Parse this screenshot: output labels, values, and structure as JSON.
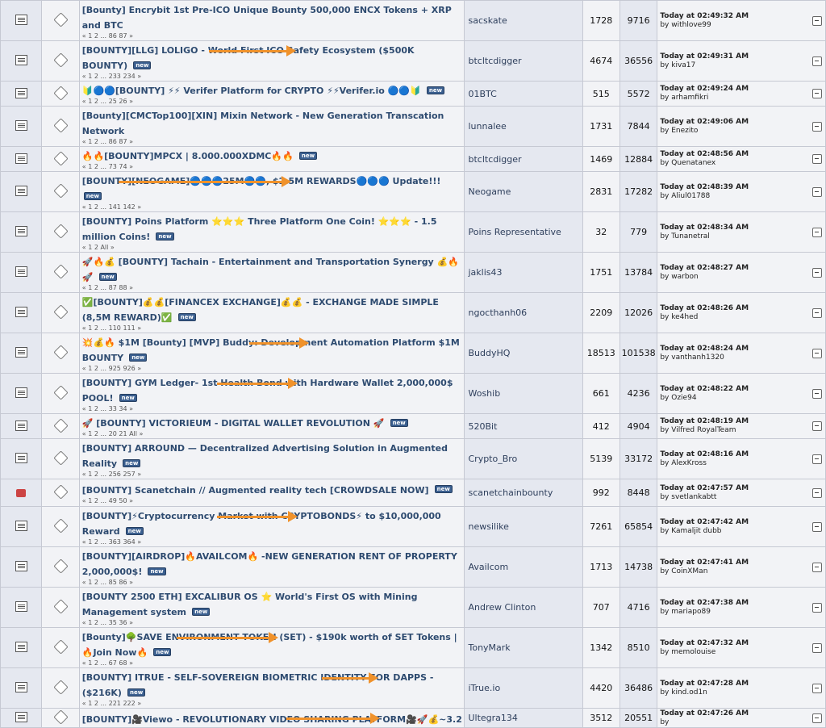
{
  "rows": [
    {
      "title": "[Bounty] Encrybit 1st Pre-ICO Unique Bounty  500,000 ENCX Tokens + XRP and BTC",
      "new": false,
      "pages": "« 1 2 ... 86 87 »",
      "author": "sacskate",
      "replies": "1728",
      "views": "9716",
      "last_time": "Today at 02:49:32 AM",
      "last_by": "withlove99",
      "icon": "doc",
      "arrow": false
    },
    {
      "title": "[BOUNTY][LLG] LOLIGO - World First ICO Safety Ecosystem ($500K BOUNTY)",
      "new": true,
      "pages": "« 1 2 ... 233 234 »",
      "author": "btcltcdigger",
      "replies": "4674",
      "views": "36556",
      "last_time": "Today at 02:49:31 AM",
      "last_by": "kiva17",
      "icon": "doc",
      "arrow": true
    },
    {
      "title": "🔰🔵🔵[BOUNTY] ⚡⚡ Verifer Platform for CRYPTO ⚡⚡Verifer.io 🔵🔵🔰",
      "new": true,
      "pages": "« 1 2 ... 25 26 »",
      "author": "01BTC",
      "replies": "515",
      "views": "5572",
      "last_time": "Today at 02:49:24 AM",
      "last_by": "arhamfikri",
      "icon": "doc",
      "arrow": false
    },
    {
      "title": "[Bounty][CMCTop100][XIN] Mixin Network - New Generation Transcation Network",
      "new": false,
      "pages": "« 1 2 ... 86 87 »",
      "author": "lunnalee",
      "replies": "1731",
      "views": "7844",
      "last_time": "Today at 02:49:06 AM",
      "last_by": "Enezito",
      "icon": "doc",
      "arrow": false
    },
    {
      "title": "🔥🔥[BOUNTY]MPCX | 8.000.000XDMC🔥🔥",
      "new": true,
      "pages": "« 1 2 ... 73 74 »",
      "author": "btcltcdigger",
      "replies": "1469",
      "views": "12884",
      "last_time": "Today at 02:48:56 AM",
      "last_by": "Quenatanex",
      "icon": "doc",
      "arrow": false
    },
    {
      "title": "[BOUNTY][NEOGAME]🔵🔵🔵25M🔵🔵, $2.5M REWARDS🔵🔵🔵 Update!!!",
      "new": true,
      "pages": "« 1 2 ... 141 142 »",
      "author": "Neogame",
      "replies": "2831",
      "views": "17282",
      "last_time": "Today at 02:48:39 AM",
      "last_by": "Aliul01788",
      "icon": "doc",
      "arrow": true
    },
    {
      "title": "[BOUNTY] Poins Platform ⭐⭐⭐ Three Platform One Coin! ⭐⭐⭐ - 1.5 million Coins!",
      "new": true,
      "pages": "« 1 2  All »",
      "author": "Poins Representative",
      "replies": "32",
      "views": "779",
      "last_time": "Today at 02:48:34 AM",
      "last_by": "Tunanetral",
      "icon": "doc",
      "arrow": false
    },
    {
      "title": "🚀🔥💰 [BOUNTY] Tachain - Entertainment and Transportation Synergy 💰🔥🚀",
      "new": true,
      "pages": "« 1 2 ... 87 88 »",
      "author": "jaklis43",
      "replies": "1751",
      "views": "13784",
      "last_time": "Today at 02:48:27 AM",
      "last_by": "warbon",
      "icon": "doc",
      "arrow": false
    },
    {
      "title": "✅[BOUNTY]💰💰[FINANCEX EXCHANGE]💰💰 - EXCHANGE MADE SIMPLE (8,5M REWARD)✅",
      "new": true,
      "pages": "« 1 2 ... 110 111 »",
      "author": "ngocthanh06",
      "replies": "2209",
      "views": "12026",
      "last_time": "Today at 02:48:26 AM",
      "last_by": "ke4hed",
      "icon": "doc",
      "arrow": false
    },
    {
      "title": "💥💰🔥 $1M [Bounty] [MVP] Buddy: Development Automation Platform $1M BOUNTY",
      "new": true,
      "pages": "« 1 2 ... 925 926 »",
      "author": "BuddyHQ",
      "replies": "18513",
      "views": "101538",
      "last_time": "Today at 02:48:24 AM",
      "last_by": "vanthanh1320",
      "icon": "doc",
      "arrow": true
    },
    {
      "title": "[BOUNTY] GYM Ledger- 1st Health Bond with Hardware Wallet 2,000,000$ POOL!",
      "new": true,
      "pages": "« 1 2 ... 33 34 »",
      "author": "Woshib",
      "replies": "661",
      "views": "4236",
      "last_time": "Today at 02:48:22 AM",
      "last_by": "Ozie94",
      "icon": "doc",
      "arrow": true
    },
    {
      "title": "🚀 [BOUNTY] VICTORIEUM - DIGITAL WALLET REVOLUTION 🚀",
      "new": true,
      "pages": "« 1 2 ... 20 21  All »",
      "author": "520Bit",
      "replies": "412",
      "views": "4904",
      "last_time": "Today at 02:48:19 AM",
      "last_by": "Vilfred RoyalTeam",
      "icon": "doc",
      "arrow": false
    },
    {
      "title": "[BOUNTY] ARROUND — Decentralized Advertising Solution in Augmented Reality",
      "new": true,
      "pages": "« 1 2 ... 256 257 »",
      "author": "Crypto_Bro",
      "replies": "5139",
      "views": "33172",
      "last_time": "Today at 02:48:16 AM",
      "last_by": "AlexKross",
      "icon": "doc",
      "arrow": false
    },
    {
      "title": "[BOUNTY] Scanetchain // Augmented reality tech [CROWDSALE NOW]",
      "new": true,
      "pages": "« 1 2 ... 49 50 »",
      "author": "scanetchainbounty",
      "replies": "992",
      "views": "8448",
      "last_time": "Today at 02:47:57 AM",
      "last_by": "svetlankabtt",
      "icon": "hot",
      "arrow": false
    },
    {
      "title": "[BOUNTY]⚡Cryptocurrency Market with CRYPTOBONDS⚡ to $10,000,000 Reward",
      "new": true,
      "pages": "« 1 2 ... 363 364 »",
      "author": "newsilike",
      "replies": "7261",
      "views": "65854",
      "last_time": "Today at 02:47:42 AM",
      "last_by": "Kamaljit dubb",
      "icon": "doc",
      "arrow": true
    },
    {
      "title": "[BOUNTY][AIRDROP]🔥AVAILCOM🔥 -NEW GENERATION RENT OF PROPERTY 2,000,000$!",
      "new": true,
      "pages": "« 1 2 ... 85 86 »",
      "author": "Availcom",
      "replies": "1713",
      "views": "14738",
      "last_time": "Today at 02:47:41 AM",
      "last_by": "CoinXMan",
      "icon": "doc",
      "arrow": false
    },
    {
      "title": "[BOUNTY 2500 ETH] EXCALIBUR OS ⭐ World's First OS with Mining Management system",
      "new": true,
      "pages": "« 1 2 ... 35 36 »",
      "author": "Andrew Clinton",
      "replies": "707",
      "views": "4716",
      "last_time": "Today at 02:47:38 AM",
      "last_by": "mariapo89",
      "icon": "doc",
      "arrow": false
    },
    {
      "title": "[Bounty]🌳SAVE ENVIRONMENT TOKEN (SET) - $190k worth of SET Tokens | 🔥Join Now🔥",
      "new": true,
      "pages": "« 1 2 ... 67 68 »",
      "author": "TonyMark",
      "replies": "1342",
      "views": "8510",
      "last_time": "Today at 02:47:32 AM",
      "last_by": "memolouise",
      "icon": "doc",
      "arrow": true
    },
    {
      "title": "[BOUNTY] ITRUE - SELF-SOVEREIGN BIOMETRIC IDENTITY FOR DAPPS - ($216K)",
      "new": true,
      "pages": "« 1 2 ... 221 222 »",
      "author": "iTrue.io",
      "replies": "4420",
      "views": "36486",
      "last_time": "Today at 02:47:28 AM",
      "last_by": "kind.od1n",
      "icon": "doc",
      "arrow": true
    },
    {
      "title": "[BOUNTY]🎥Viewo - REVOLUTIONARY VIDEO SHARING PLATFORM🎥🚀💰~3.2",
      "new": false,
      "pages": "",
      "author": "Ultegra134",
      "replies": "3512",
      "views": "20551",
      "last_time": "Today at 02:47:26 AM",
      "last_by": "",
      "icon": "doc",
      "arrow": true
    }
  ],
  "new_label": "new",
  "arrow_color": "#f0922b"
}
